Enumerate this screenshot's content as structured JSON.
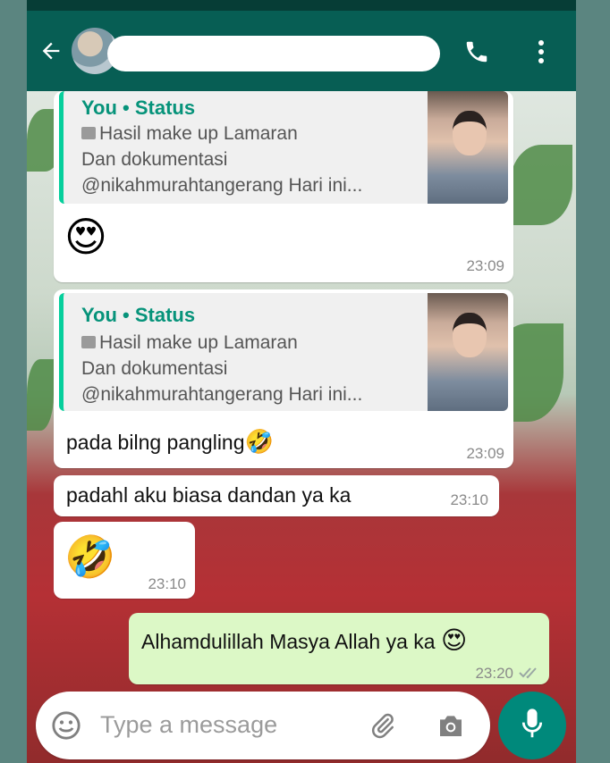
{
  "header": {
    "contact_name": "",
    "icons": {
      "back": "back-arrow-icon",
      "call": "phone-icon",
      "menu": "more-vert-icon"
    }
  },
  "colors": {
    "header": "#075e54",
    "accent": "#06cf9c",
    "outgoing": "#dcf8c6",
    "mic": "#00897b"
  },
  "messages": [
    {
      "quote": {
        "author": "You • Status",
        "lines": [
          "Hasil make up Lamaran",
          "Dan  dokumentasi",
          "@nikahmurahtangerang Hari ini..."
        ]
      },
      "text": "😍",
      "time": "23:09"
    },
    {
      "quote": {
        "author": "You • Status",
        "lines": [
          "Hasil make up Lamaran",
          "Dan  dokumentasi",
          "@nikahmurahtangerang Hari ini..."
        ]
      },
      "text": "pada bilng pangling",
      "emoji": "🤣",
      "time": "23:09"
    },
    {
      "text": "padahl aku biasa dandan ya ka",
      "time": "23:10"
    },
    {
      "text": "🤣",
      "time": "23:10"
    },
    {
      "text": "Alhamdulillah Masya Allah ya ka",
      "emoji": "😍",
      "time": "23:20",
      "status": "read-double-check"
    }
  ],
  "composer": {
    "placeholder": "Type a message",
    "icons": {
      "emoji": "smiley-icon",
      "attach": "paperclip-icon",
      "camera": "camera-icon",
      "mic": "mic-icon"
    }
  }
}
